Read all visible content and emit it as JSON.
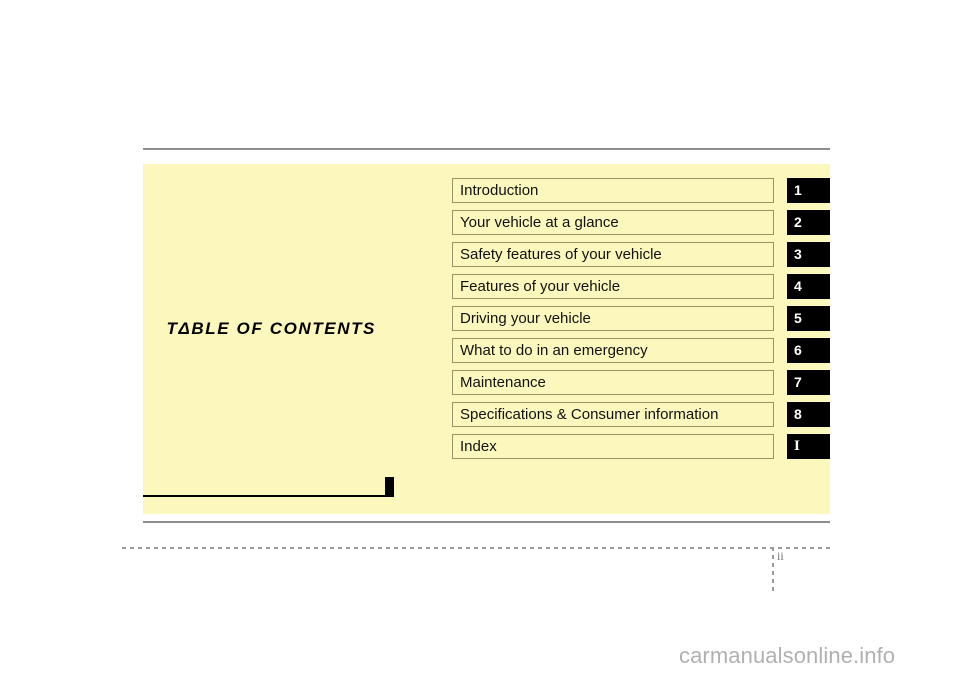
{
  "page": {
    "number": "ii",
    "watermark": "carmanualsonline.info",
    "panel_color": "#FCF8BD",
    "badge_color": "#000000",
    "rule_color": "#8D8D8D"
  },
  "heading": {
    "title": "TΔBLE  OF  CONTENTS"
  },
  "contents": {
    "rows": [
      {
        "label": "Introduction",
        "number": "1"
      },
      {
        "label": "Your vehicle at a glance",
        "number": "2"
      },
      {
        "label": "Safety features of your vehicle",
        "number": "3"
      },
      {
        "label": "Features of your vehicle",
        "number": "4"
      },
      {
        "label": "Driving your vehicle",
        "number": "5"
      },
      {
        "label": "What to do in an emergency",
        "number": "6"
      },
      {
        "label": "Maintenance",
        "number": "7"
      },
      {
        "label": "Specifications & Consumer information",
        "number": "8"
      },
      {
        "label": "Index",
        "number": "I"
      }
    ]
  }
}
